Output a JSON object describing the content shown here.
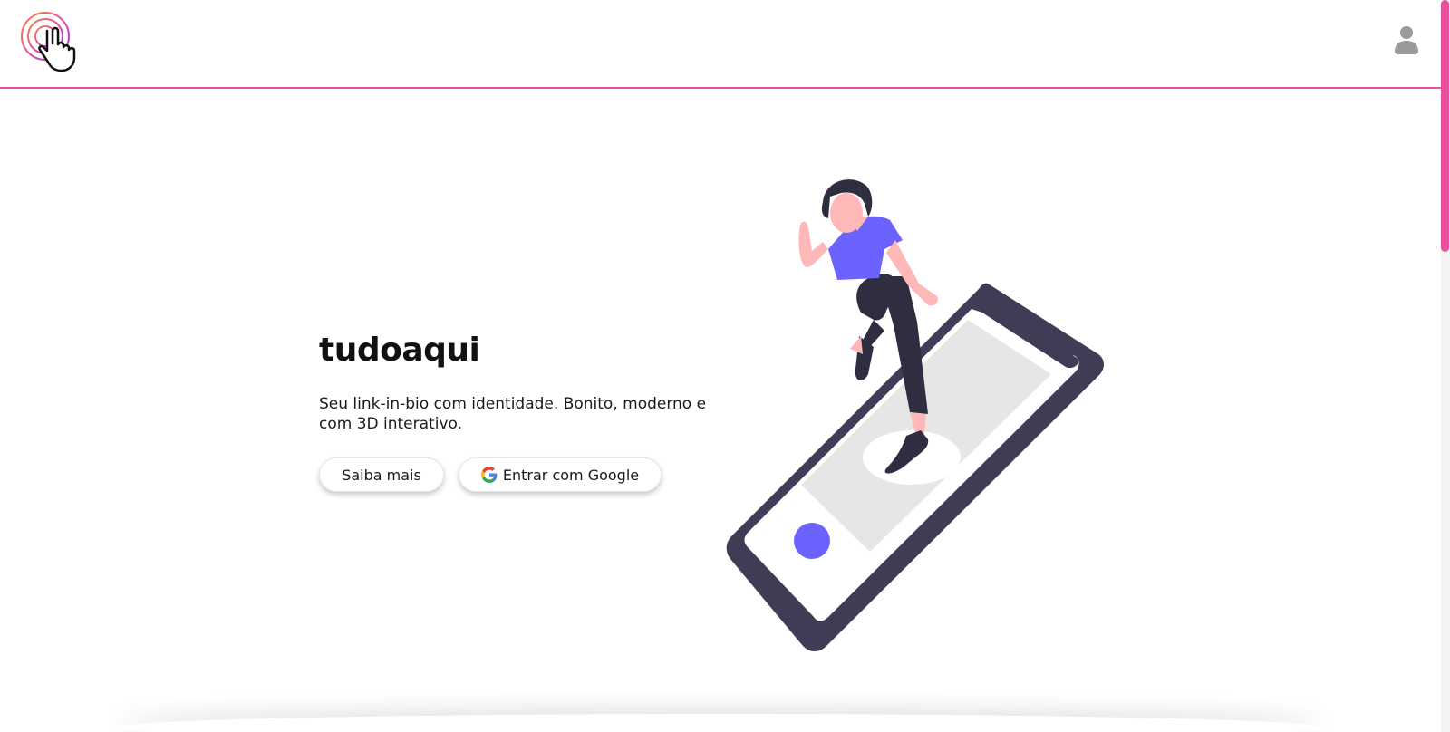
{
  "header": {
    "logo_icon": "touch-tap-icon",
    "user_icon": "user-avatar-icon",
    "accent_color": "#e84f9c"
  },
  "hero": {
    "title": "tudoaqui",
    "subtitle": "Seu link-in-bio com identidade. Bonito, moderno e com 3D interativo.",
    "buttons": {
      "learn_more": "Saiba mais",
      "google_login": "Entrar com Google"
    },
    "illustration_icon": "woman-on-phone-illustration"
  },
  "colors": {
    "accent": "#e84f9c",
    "illustration_primary": "#6c63ff",
    "phone_frame": "#3f3d56"
  }
}
